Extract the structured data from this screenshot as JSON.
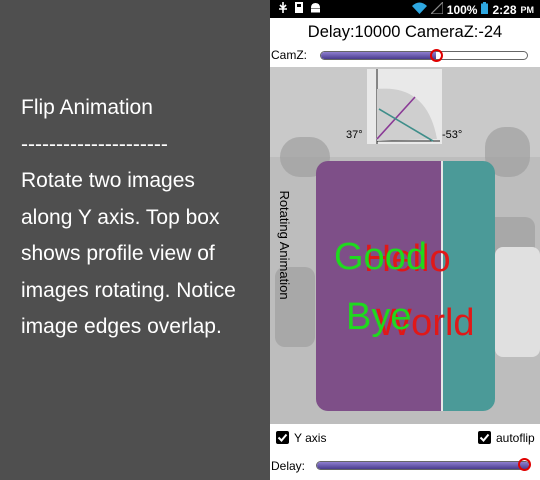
{
  "left": {
    "lines": [
      "Flip Animation",
      "---------------------",
      "Rotate two images",
      "along Y axis.  Top box",
      "shows profile view of",
      "images rotating. Notice",
      "image edges overlap."
    ]
  },
  "statusbar": {
    "battery_percent": "100%",
    "time": "2:28",
    "ampm": "PM",
    "icons": [
      "usb-icon",
      "sd-card-icon",
      "android-icon",
      "wifi-icon",
      "signal-icon",
      "battery-icon"
    ]
  },
  "header": {
    "title": "Delay:10000 CameraZ:-24"
  },
  "camz": {
    "label": "CamZ:",
    "level": 0.56
  },
  "stage": {
    "angle_left": "37°",
    "angle_right": "-53°",
    "vertical_label": "Rotating Animation",
    "front_text": [
      "Good",
      "Bye"
    ],
    "back_text": [
      "Hello",
      "World"
    ],
    "colors": {
      "front_text": "#1fd91f",
      "back_text": "#e01818",
      "left_card": "#7e4f88",
      "right_card": "#4b9a98"
    }
  },
  "controls": {
    "y_axis_label": "Y axis",
    "y_axis_checked": true,
    "autoflip_label": "autoflip",
    "autoflip_checked": true,
    "delay_label": "Delay:",
    "delay_level": 1.0
  }
}
